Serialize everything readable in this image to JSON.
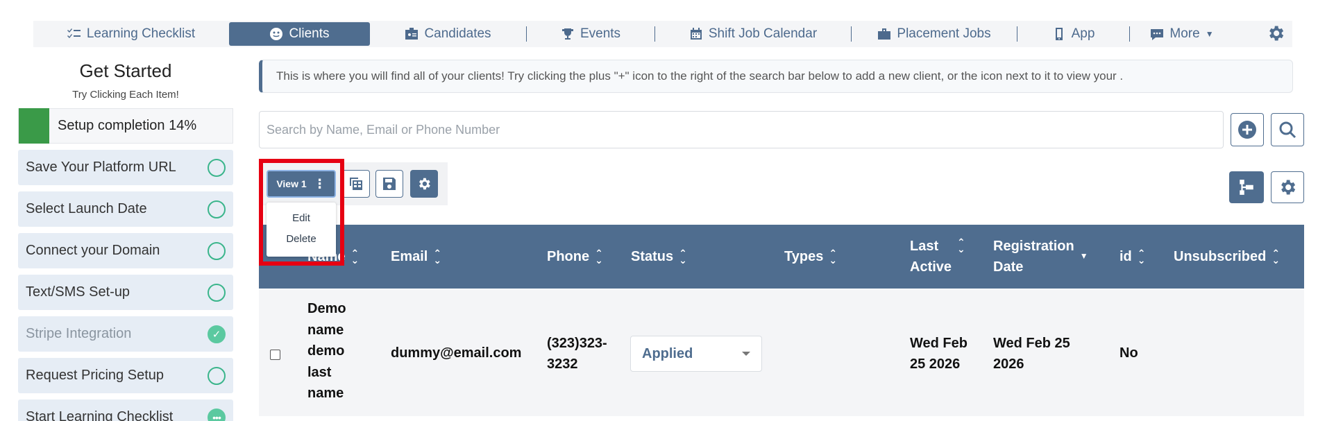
{
  "nav": {
    "items": [
      {
        "label": "Learning Checklist",
        "icon": "checklist-icon"
      },
      {
        "label": "Clients",
        "icon": "face-icon"
      },
      {
        "label": "Candidates",
        "icon": "id-card-icon"
      },
      {
        "label": "Events",
        "icon": "trophy-icon"
      },
      {
        "label": "Shift Job Calendar",
        "icon": "calendar-icon"
      },
      {
        "label": "Placement Jobs",
        "icon": "briefcase-icon"
      },
      {
        "label": "App",
        "icon": "phone-icon"
      },
      {
        "label": "More",
        "icon": "chat-icon"
      }
    ],
    "active": "Clients"
  },
  "sidebar": {
    "title": "Get Started",
    "subtitle": "Try Clicking Each Item!",
    "progress_label": "Setup completion 14%",
    "progress_percent": 14,
    "items": [
      {
        "label": "Save Your Platform URL",
        "state": "todo"
      },
      {
        "label": "Select Launch Date",
        "state": "todo"
      },
      {
        "label": "Connect your Domain",
        "state": "todo"
      },
      {
        "label": "Text/SMS Set-up",
        "state": "todo"
      },
      {
        "label": "Stripe Integration",
        "state": "done"
      },
      {
        "label": "Request Pricing Setup",
        "state": "todo"
      },
      {
        "label": "Start Learning Checklist",
        "state": "in-progress"
      }
    ]
  },
  "info_banner": "This is where you will find all of your clients! Try clicking the plus \"+\" icon to the right of the search bar below to add a new client, or the icon next to it to view your .",
  "search": {
    "placeholder": "Search by Name, Email or Phone Number",
    "value": ""
  },
  "view": {
    "label": "View 1",
    "menu": [
      "Edit",
      "Delete"
    ]
  },
  "table": {
    "headers": {
      "name": "Name",
      "email": "Email",
      "phone": "Phone",
      "status": "Status",
      "types": "Types",
      "last_active_1": "Last",
      "last_active_2": "Active",
      "registration_1": "Registration",
      "registration_2": "Date",
      "id": "id",
      "unsubscribed": "Unsubscribed"
    },
    "row": {
      "name_lines": [
        "Demo",
        "name",
        "demo",
        "last",
        "name"
      ],
      "email": "dummy@email.com",
      "phone_1": "(323)323-",
      "phone_2": "3232",
      "status": "Applied",
      "types": "",
      "last_active_1": "Wed Feb",
      "last_active_2": "25 2026",
      "registration_1": "Wed Feb 25",
      "registration_2": "2026",
      "id": "No",
      "unsubscribed": ""
    }
  },
  "colors": {
    "primary": "#4f6d8f",
    "highlight": "#e60012",
    "progress": "#3a9a48",
    "check": "#3ab58b"
  }
}
